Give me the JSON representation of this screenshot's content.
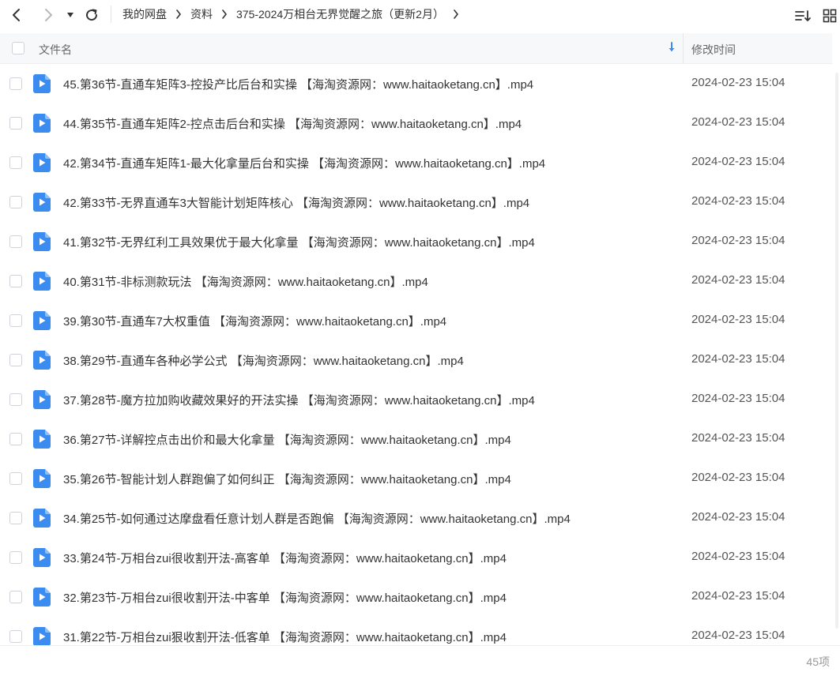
{
  "breadcrumb": {
    "items": [
      "我的网盘",
      "资料",
      "375-2024万相台无界觉醒之旅（更新2月）"
    ]
  },
  "header": {
    "name_col": "文件名",
    "time_col": "修改时间"
  },
  "icons": {
    "back": "chevron-left-icon",
    "forward": "chevron-right-icon",
    "history": "caret-down-icon",
    "refresh": "refresh-icon",
    "sort": "sort-list-icon",
    "view": "grid-view-icon",
    "file": "video-file-icon"
  },
  "colors": {
    "file_icon": "#3b8cf0",
    "sort_arrow": "#3b8cf0"
  },
  "files": [
    {
      "name": "45.第36节-直通车矩阵3-控投产比后台和实操 【海淘资源网：www.haitaoketang.cn】.mp4",
      "time": "2024-02-23 15:04"
    },
    {
      "name": "44.第35节-直通车矩阵2-控点击后台和实操 【海淘资源网：www.haitaoketang.cn】.mp4",
      "time": "2024-02-23 15:04"
    },
    {
      "name": "42.第34节-直通车矩阵1-最大化拿量后台和实操 【海淘资源网：www.haitaoketang.cn】.mp4",
      "time": "2024-02-23 15:04"
    },
    {
      "name": "42.第33节-无界直通车3大智能计划矩阵核心 【海淘资源网：www.haitaoketang.cn】.mp4",
      "time": "2024-02-23 15:04"
    },
    {
      "name": "41.第32节-无界红利工具效果优于最大化拿量 【海淘资源网：www.haitaoketang.cn】.mp4",
      "time": "2024-02-23 15:04"
    },
    {
      "name": "40.第31节-非标测款玩法 【海淘资源网：www.haitaoketang.cn】.mp4",
      "time": "2024-02-23 15:04"
    },
    {
      "name": "39.第30节-直通车7大权重值 【海淘资源网：www.haitaoketang.cn】.mp4",
      "time": "2024-02-23 15:04"
    },
    {
      "name": "38.第29节-直通车各种必学公式 【海淘资源网：www.haitaoketang.cn】.mp4",
      "time": "2024-02-23 15:04"
    },
    {
      "name": "37.第28节-魔方拉加购收藏效果好的开法实操 【海淘资源网：www.haitaoketang.cn】.mp4",
      "time": "2024-02-23 15:04"
    },
    {
      "name": "36.第27节-详解控点击出价和最大化拿量 【海淘资源网：www.haitaoketang.cn】.mp4",
      "time": "2024-02-23 15:04"
    },
    {
      "name": "35.第26节-智能计划人群跑偏了如何纠正 【海淘资源网：www.haitaoketang.cn】.mp4",
      "time": "2024-02-23 15:04"
    },
    {
      "name": "34.第25节-如何通过达摩盘看任意计划人群是否跑偏 【海淘资源网：www.haitaoketang.cn】.mp4",
      "time": "2024-02-23 15:04"
    },
    {
      "name": "33.第24节-万相台zui很收割开法-高客单 【海淘资源网：www.haitaoketang.cn】.mp4",
      "time": "2024-02-23 15:04"
    },
    {
      "name": "32.第23节-万相台zui很收割开法-中客单 【海淘资源网：www.haitaoketang.cn】.mp4",
      "time": "2024-02-23 15:04"
    },
    {
      "name": "31.第22节-万相台zui狠收割开法-低客单 【海淘资源网：www.haitaoketang.cn】.mp4",
      "time": "2024-02-23 15:04"
    }
  ],
  "footer": {
    "count": "45项"
  }
}
